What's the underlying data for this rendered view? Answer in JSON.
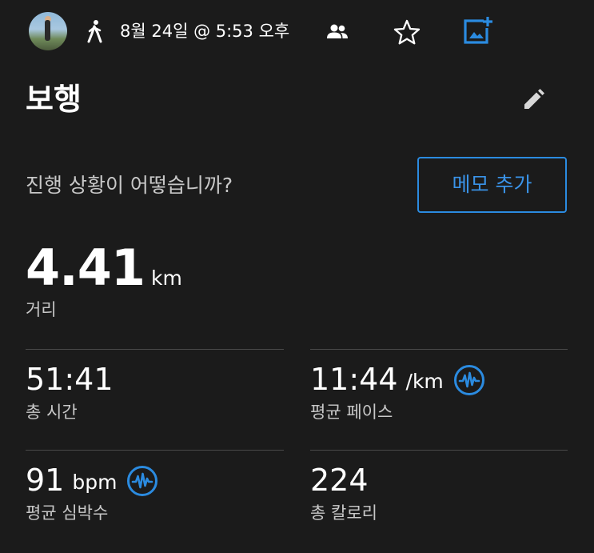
{
  "header": {
    "date_time": "8월 24일 @ 5:53 오후",
    "icons": {
      "activity_type": "walk-icon",
      "privacy": "people-icon",
      "favorite": "star-icon",
      "add_photo": "add-photo-icon"
    },
    "accent_color": "#2b8be0"
  },
  "activity": {
    "title": "보행",
    "edit_icon": "pencil-icon"
  },
  "notes": {
    "prompt": "진행 상황이 어떻습니까?",
    "add_memo_label": "메모 추가"
  },
  "distance": {
    "value": "4.41",
    "unit": "km",
    "label": "거리"
  },
  "stats": [
    {
      "value": "51:41",
      "unit": "",
      "label": "총 시간"
    },
    {
      "value": "11:44",
      "unit": "/km",
      "label": "평균 페이스",
      "icon": "pulse-chart-icon"
    },
    {
      "value": "91",
      "unit": "bpm",
      "label": "평균 심박수",
      "icon": "pulse-chart-icon"
    },
    {
      "value": "224",
      "unit": "",
      "label": "총 칼로리"
    }
  ]
}
